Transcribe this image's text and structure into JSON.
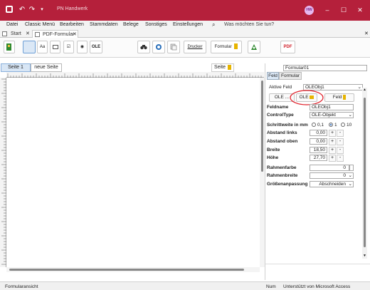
{
  "titlebar": {
    "app_title": "PN Handwerk",
    "user_initials": "HW"
  },
  "menu": {
    "items": [
      "Datei",
      "Classic Menü",
      "Bearbeiten",
      "Stammdaten",
      "Belege",
      "Sonstiges",
      "Einstellungen"
    ],
    "search_text": "Was möchten Sie tun?"
  },
  "tabs": {
    "start": "Start",
    "pdf": "PDF-Formular"
  },
  "toolbar": {
    "text_label": "Aa",
    "ole_label": "OLE",
    "drucker_label": "Drucker",
    "formular_label": "Formular",
    "pdf_label": "PDF"
  },
  "pages": {
    "page1": "Seite 1",
    "new_page": "neue Seite",
    "page_btn": "Seite"
  },
  "panel": {
    "form_name": "Formular01",
    "tab_feld": "Feld",
    "tab_formular": "Formular",
    "active_field_label": "Aktive Feld",
    "active_field_value": "OLEObj1",
    "btn_ole_dots": "OLE ...",
    "btn_ole": "OLE",
    "btn_feld": "Feld",
    "feldname_label": "Feldname",
    "feldname_value": "OLEObj1",
    "controltype_label": "ControlType",
    "controltype_value": "OLE-Objekt",
    "schrittweite_label": "Schrittweite in mm",
    "step_opts": [
      "0,1",
      "1",
      "10"
    ],
    "abstand_links_label": "Abstand links",
    "abstand_links_value": "0,00",
    "abstand_oben_label": "Abstand oben",
    "abstand_oben_value": "0,00",
    "breite_label": "Breite",
    "breite_value": "18,50",
    "hoehe_label": "Höhe",
    "hoehe_value": "27,70",
    "rahmenfarbe_label": "Rahmenfarbe",
    "rahmenfarbe_value": "0",
    "rahmenbreite_label": "Rahmenbreite",
    "rahmenbreite_value": "0",
    "groessen_label": "Größenanpassung",
    "groessen_value": "Abschneiden",
    "plus": "+",
    "minus": "-"
  },
  "statusbar": {
    "left": "Formularansicht",
    "num": "Num",
    "right": "Unterstützt von Microsoft Access"
  },
  "colors": {
    "accent": "#b5203b",
    "highlight_circle": "#e0202a"
  }
}
